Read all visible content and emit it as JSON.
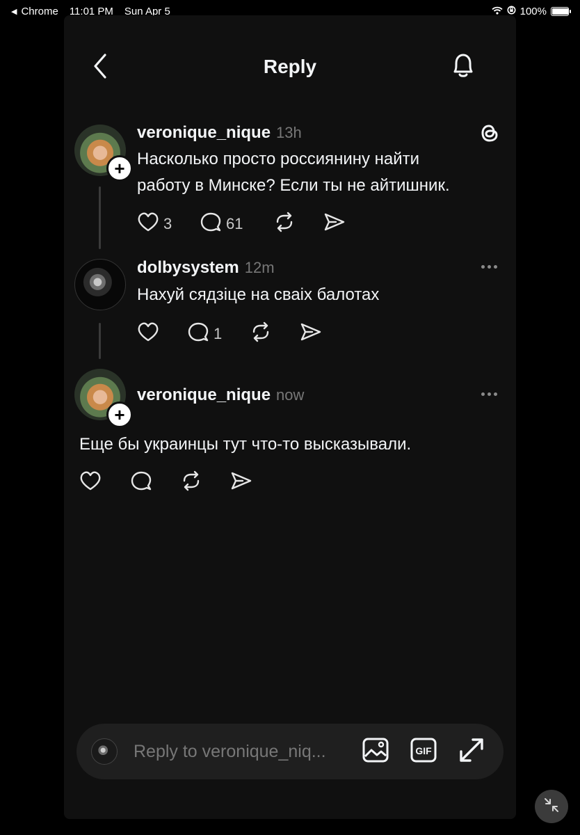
{
  "status_bar": {
    "back_app": "Chrome",
    "time": "11:01 PM",
    "date": "Sun Apr 5",
    "battery": "100%",
    "battery_level": 1.0
  },
  "header": {
    "title": "Reply",
    "back_icon": "chevron-left-icon",
    "bell_icon": "bell-icon"
  },
  "posts": [
    {
      "username": "veronique_nique",
      "time": "13h",
      "text_line1": "Насколько просто россиянину найти",
      "text_line2": "работу в Минске? Если ты не айтишник.",
      "likes": "3",
      "comments": "61",
      "corner_icon": "threads-logo-icon"
    },
    {
      "username": "dolbysystem",
      "time": "12m",
      "text": "Нахуй сядзіце на сваіх балотах",
      "likes": "",
      "comments": "1",
      "corner_icon": "more-icon"
    },
    {
      "username": "veronique_nique",
      "time": "now",
      "text": "Еще бы украинцы тут что-то высказывали.",
      "corner_icon": "more-icon"
    }
  ],
  "composer": {
    "placeholder": "Reply to veronique_niq..."
  },
  "colors": {
    "background": "#101010",
    "text": "#f3f5f7",
    "muted": "#777777",
    "composer_bg": "#1f1f1f"
  }
}
